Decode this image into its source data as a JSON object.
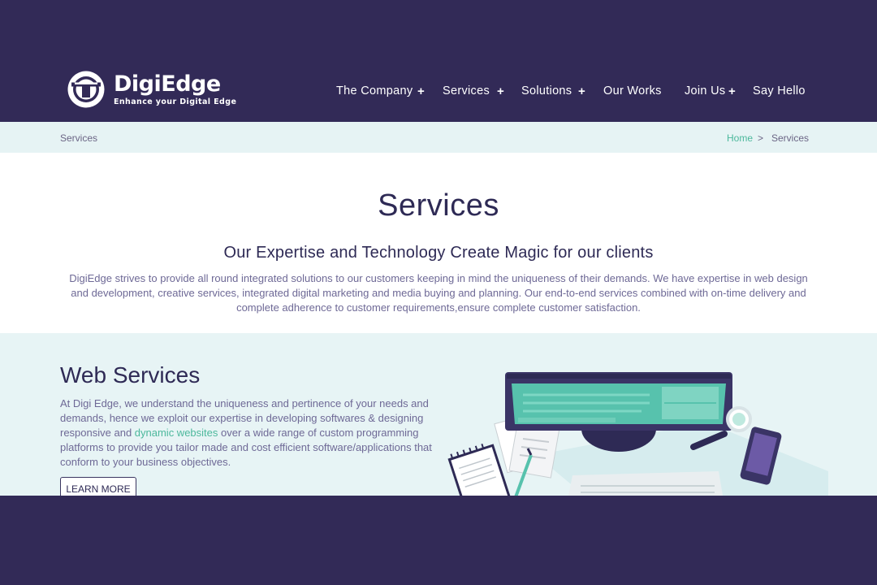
{
  "brand": {
    "name": "DigiEdge",
    "tagline": "Enhance your Digital Edge",
    "logo_icon": "digiedge-logo-icon"
  },
  "nav": {
    "items": [
      {
        "label": "The Company",
        "has_submenu": true
      },
      {
        "label": "Services",
        "has_submenu": true
      },
      {
        "label": "Solutions",
        "has_submenu": true
      },
      {
        "label": "Our Works",
        "has_submenu": false
      },
      {
        "label": "Join Us",
        "has_submenu": true
      },
      {
        "label": "Say Hello",
        "has_submenu": false
      }
    ],
    "submenu_symbol": "+"
  },
  "breadcrumb": {
    "current_page": "Services",
    "home": "Home",
    "separator": ">",
    "current": "Services"
  },
  "intro": {
    "title": "Services",
    "subtitle": "Our Expertise and Technology Create Magic for our clients",
    "description": "DigiEdge strives to provide all round integrated solutions to our customers keeping in mind the uniqueness of their demands. We have expertise in web design and development, creative services, integrated digital marketing and media buying and planning. Our end-to-end services combined with on-time delivery and complete adherence to customer requirements,ensure complete customer satisfaction."
  },
  "web_services": {
    "title": "Web Services",
    "text_before": "At Digi Edge, we understand the uniqueness and pertinence of your needs and demands, hence we exploit our expertise in developing softwares & designing responsive and ",
    "link_text": "dynamic websites",
    "text_after": " over a wide range of custom programming platforms to provide you tailor made and cost efficient software/applications that conform to your business objectives.",
    "button_label": "LEARN MORE",
    "illustration": "desk-workspace-illustration"
  },
  "colors": {
    "brand_dark": "#322a57",
    "accent_green": "#4cb89c",
    "light_band": "#e6f3f4",
    "body_text": "#6e6996"
  }
}
